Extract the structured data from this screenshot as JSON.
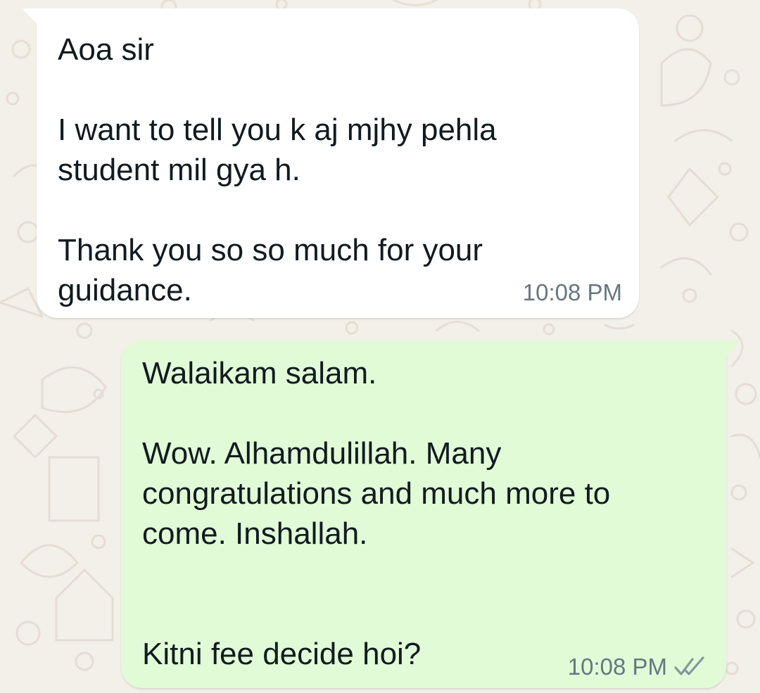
{
  "chat": {
    "messages": [
      {
        "direction": "incoming",
        "text": "Aoa sir\n\nI want to tell you k aj mjhy pehla student mil gya h.\n\nThank you so so much for your guidance.",
        "time": "10:08 PM"
      },
      {
        "direction": "outgoing",
        "text": "Walaikam salam.\n\nWow. Alhamdulillah. Many congratulations and much more to come. Inshallah.\n\n\nKitni fee decide hoi?",
        "time": "10:08 PM",
        "status_icon": "double-check-icon"
      }
    ]
  },
  "colors": {
    "wallpaper": "#f3efe9",
    "incoming_bubble": "#ffffff",
    "outgoing_bubble": "#e1fbd6",
    "timestamp": "#667781",
    "read_receipt": "#8696a0"
  }
}
